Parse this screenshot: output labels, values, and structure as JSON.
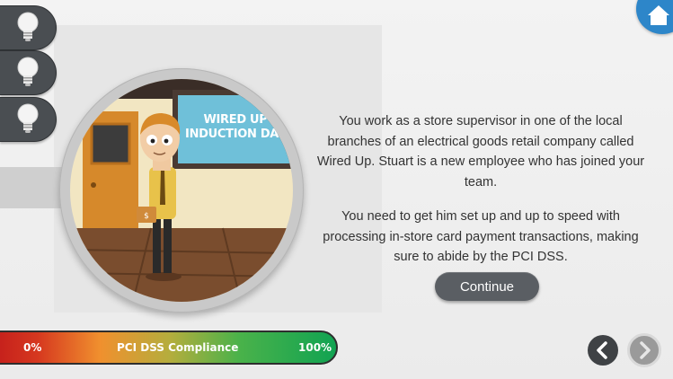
{
  "hints": [
    {
      "icon": "lightbulb-icon"
    },
    {
      "icon": "lightbulb-icon"
    },
    {
      "icon": "lightbulb-icon"
    }
  ],
  "scene": {
    "sign_line1": "WIRED UP",
    "sign_line2": "INDUCTION DAY"
  },
  "narrative": {
    "paragraph1": "You work as a store supervisor in one of the local branches of an electrical goods retail company called Wired Up. Stuart is a new employee who has joined your team.",
    "paragraph2": "You need to get him set up and up to speed with processing in-store card payment transactions, making sure to abide by the PCI DSS."
  },
  "continue_label": "Continue",
  "compliance": {
    "min_label": "0%",
    "title": "PCI DSS Compliance",
    "max_label": "100%"
  },
  "nav": {
    "prev_icon": "chevron-left-icon",
    "next_icon": "chevron-right-icon",
    "home_icon": "home-icon"
  },
  "colors": {
    "accent": "#2d86c9",
    "button": "#5a5e63",
    "tab": "#4a4e52"
  }
}
